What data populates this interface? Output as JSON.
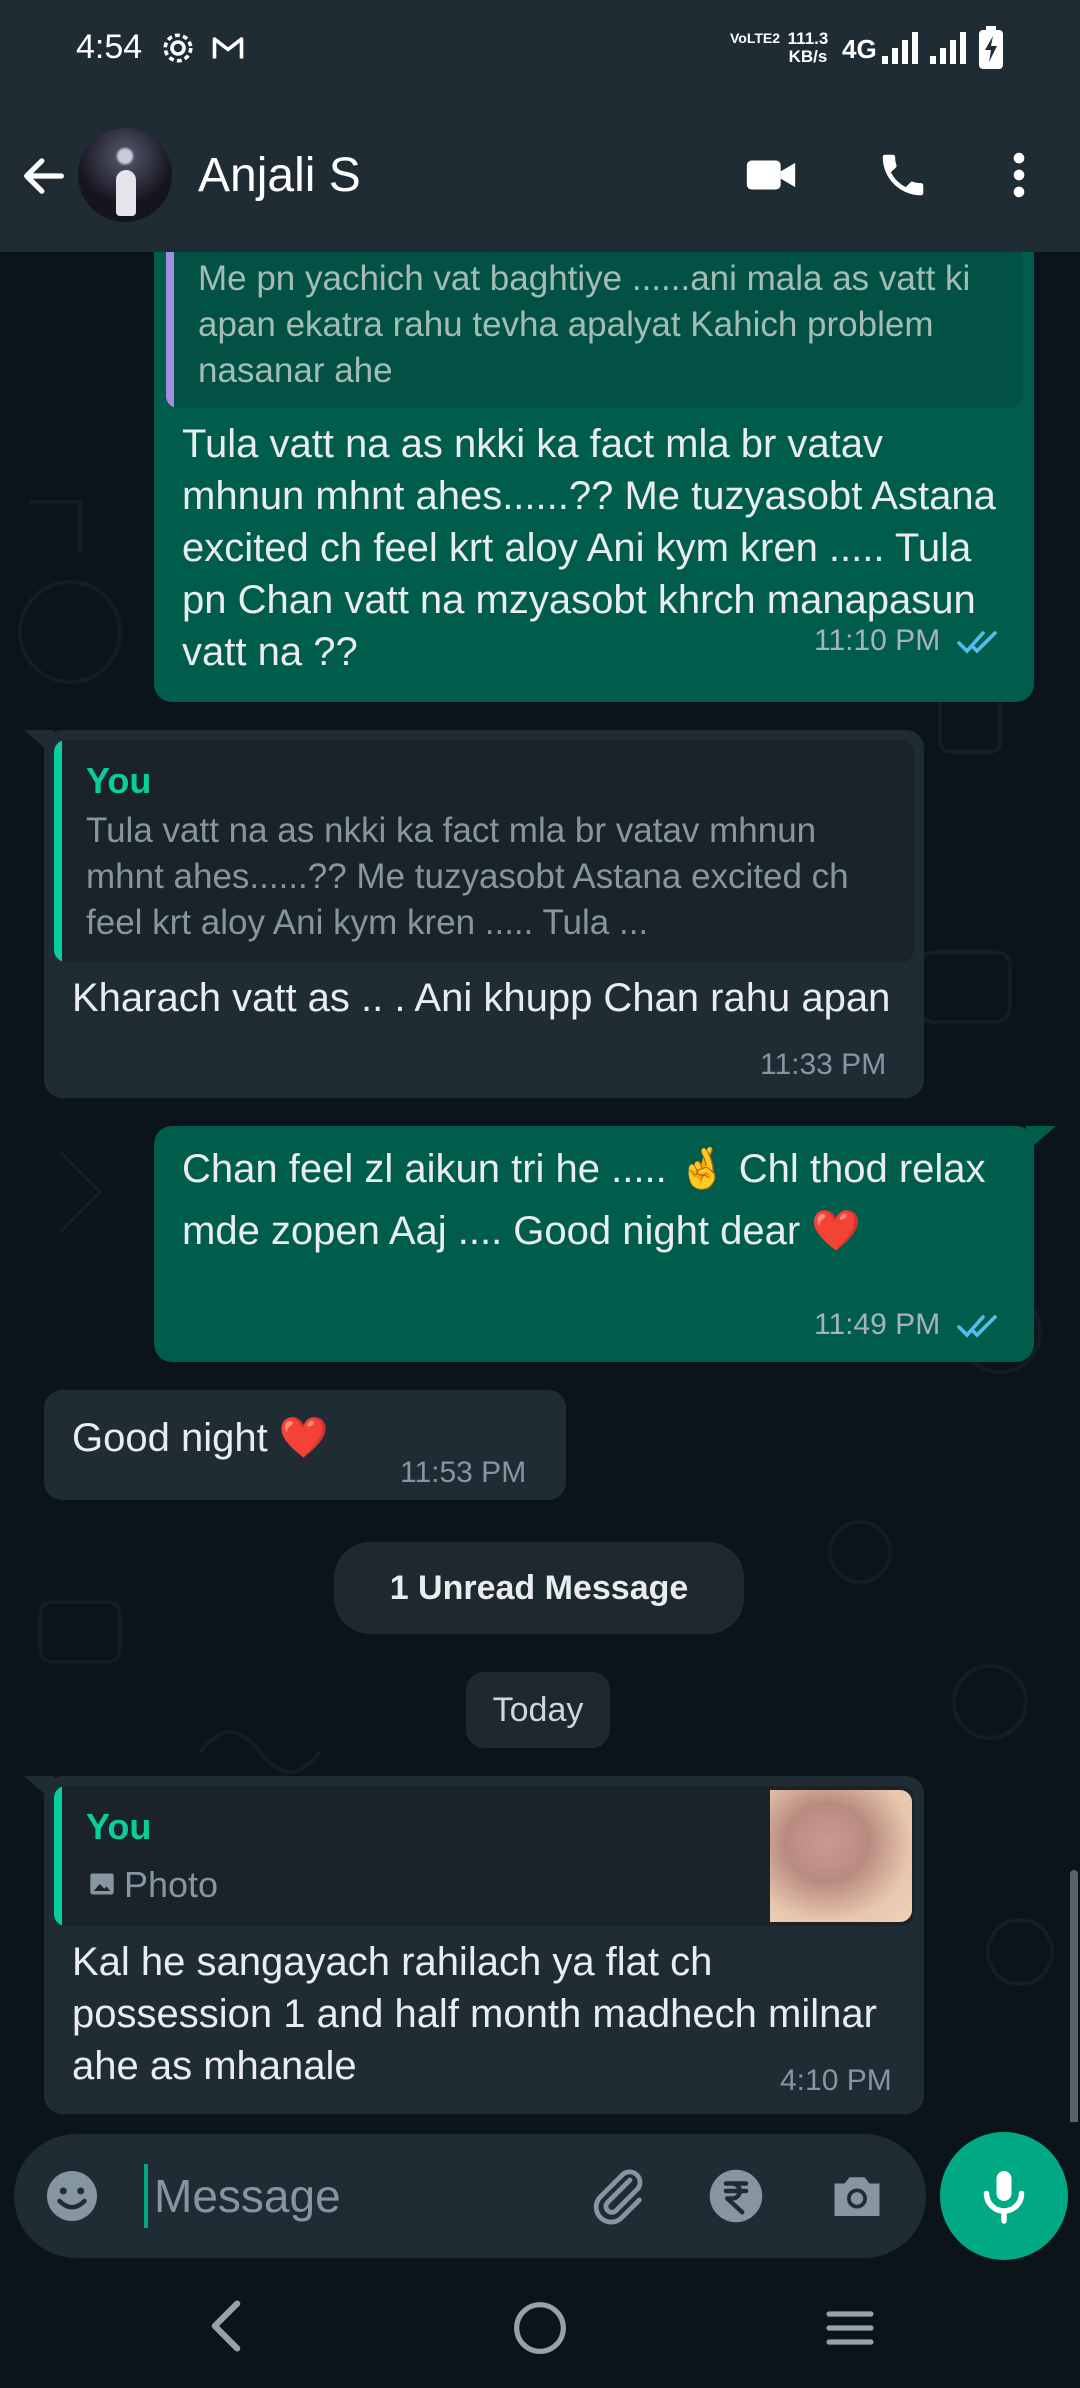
{
  "status_bar": {
    "time": "4:54",
    "volte_label": "VoLTE2",
    "speed_value": "111.3",
    "speed_unit": "KB/s",
    "network": "4G"
  },
  "header": {
    "contact_name": "Anjali S"
  },
  "messages": [
    {
      "direction": "outgoing",
      "quoted_text": "Me pn yachich vat baghtiye ......ani mala as vatt ki apan ekatra rahu tevha apalyat Kahich problem nasanar ahe",
      "text": "Tula vatt na as nkki ka fact mla br vatav mhnun mhnt ahes......?? Me tuzyasobt Astana excited ch feel krt aloy Ani kym kren ..... Tula pn Chan vatt na mzyasobt khrch manapasun vatt na ??",
      "time": "11:10 PM"
    },
    {
      "direction": "incoming",
      "quoted_author": "You",
      "quoted_text": "Tula vatt na as nkki ka fact mla br vatav mhnun mhnt ahes......?? Me tuzyasobt Astana excited ch feel krt aloy Ani kym kren ..... Tula ...",
      "text": "Kharach vatt as .. . Ani khupp Chan rahu apan",
      "time": "11:33 PM"
    },
    {
      "direction": "outgoing",
      "text": "Chan feel zl aikun tri he ..... 🤞 Chl thod relax mde zopen Aaj .... Good night dear ❤️",
      "time": "11:49 PM"
    },
    {
      "direction": "incoming",
      "text": "Good night ❤️",
      "time": "11:53 PM"
    },
    {
      "direction": "incoming",
      "quoted_author": "You",
      "quoted_media_label": "Photo",
      "text": "Kal he sangayach rahilach ya flat ch possession 1 and half month madhech milnar ahe as mhanale",
      "time": "4:10 PM"
    }
  ],
  "unread_banner": "1 Unread Message",
  "date_separator": "Today",
  "composer": {
    "placeholder": "Message"
  },
  "colors": {
    "outgoing_bubble": "#005c4b",
    "incoming_bubble": "#202c33",
    "accent": "#00a884",
    "quote_author": "#06cf9c",
    "read_ticks": "#53bdeb"
  }
}
